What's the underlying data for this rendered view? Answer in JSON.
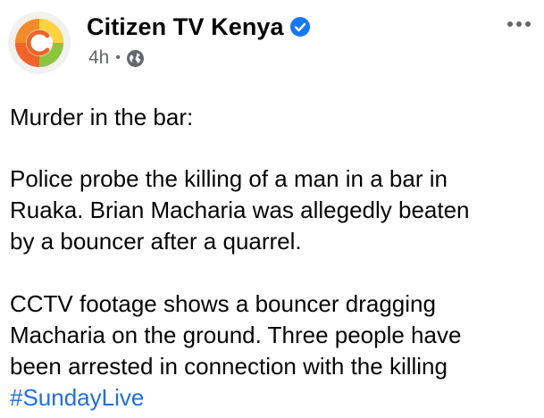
{
  "post": {
    "page_name": "Citizen TV Kenya",
    "time": "4h",
    "separator": "•",
    "icons": {
      "avatar": "citizen-tv-logo",
      "verified": "verified-badge-icon",
      "audience": "globe-icon",
      "more": "more-options-icon"
    },
    "colors": {
      "hashtag": "#216fdb",
      "verified": "#1877f2",
      "meta": "#65676b"
    },
    "body": {
      "headline": "Murder in the bar:",
      "paragraph1_lines": [
        "Police probe the killing of a man in a bar in",
        "Ruaka. Brian Macharia was allegedly beaten",
        "by a bouncer after a quarrel."
      ],
      "paragraph2_lines": [
        "CCTV footage shows a bouncer dragging",
        "Macharia on the ground. Three people have",
        "been arrested in connection with the killing"
      ],
      "hashtag": "#SundayLive"
    }
  }
}
